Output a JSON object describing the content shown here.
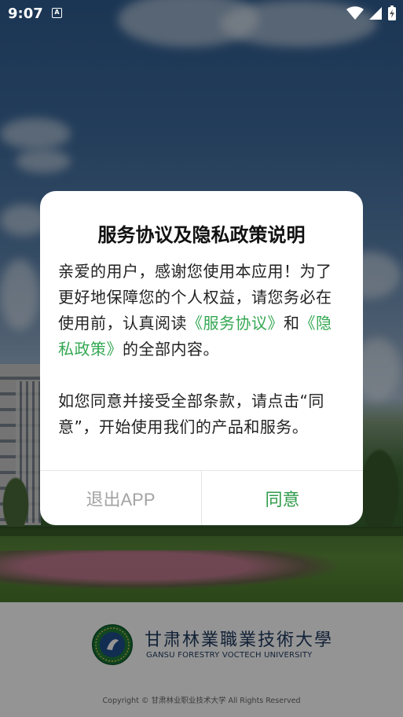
{
  "status_bar": {
    "time": "9:07",
    "notification_icon": "A",
    "icons": [
      "wifi-icon",
      "cell-signal-icon",
      "battery-charging-icon"
    ]
  },
  "footer": {
    "university_cn": "甘肃林業職業技術大學",
    "university_en": "GANSU FORESTRY VOCTECH UNIVERSITY",
    "copyright": "Copyright © 甘肃林业职业技术大学 All Rights Reserved"
  },
  "dialog": {
    "title": "服务协议及隐私政策说明",
    "para1_a": "亲爱的用户，感谢您使用本应用！为了更好地保障您的个人权益，请您务必在使用前，认真阅读",
    "link_service": "《服务协议》",
    "para1_and": "和",
    "link_privacy": "《隐私政策》",
    "para1_b": "的全部内容。",
    "para2": "如您同意并接受全部条款，请点击“同意”，开始使用我们的产品和服务。",
    "exit_label": "退出APP",
    "agree_label": "同意"
  },
  "colors": {
    "link": "#34a853",
    "agree": "#2e9a4a",
    "exit": "#a3a3a3"
  }
}
